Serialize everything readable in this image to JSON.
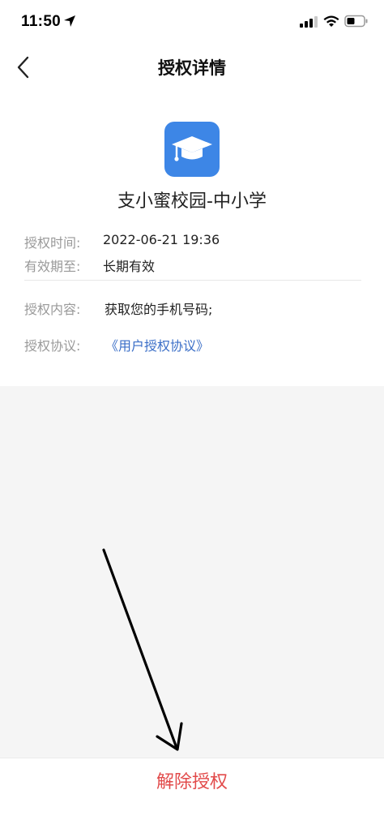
{
  "status_bar": {
    "time": "11:50",
    "icons": [
      "location-arrow-icon",
      "cellular-signal-icon",
      "wifi-icon",
      "battery-icon"
    ]
  },
  "nav": {
    "title": "授权详情",
    "back_icon": "chevron-left-icon"
  },
  "app": {
    "icon": "graduation-cap-icon",
    "icon_color": "#3d86e6",
    "name": "支小蜜校园-中小学"
  },
  "info": {
    "auth_time_label": "授权时间:",
    "auth_time_value": "2022-06-21 19:36",
    "validity_label": "有效期至:",
    "validity_value": "长期有效",
    "content_label": "授权内容:",
    "content_value": "获取您的手机号码;",
    "agreement_label": "授权协议:",
    "agreement_value": "《用户授权协议》"
  },
  "footer": {
    "revoke_label": "解除授权",
    "revoke_color": "#e24a4a"
  },
  "colors": {
    "link": "#3a6ec7",
    "label_gray": "#999999",
    "page_bg": "#f5f5f5"
  }
}
